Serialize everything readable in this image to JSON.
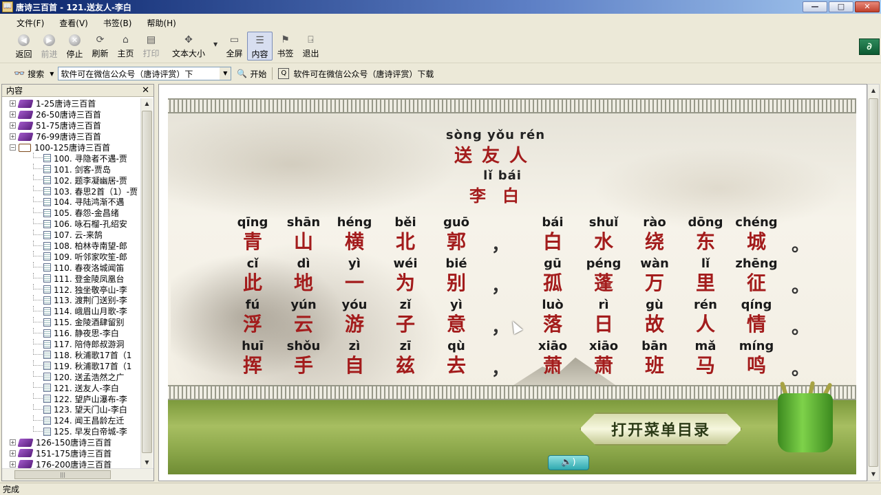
{
  "window": {
    "title": "唐诗三百首 - 121.送友人-李白",
    "buttons": {
      "minimize": "—",
      "maximize": "□",
      "close": "✕"
    }
  },
  "menu": [
    "文件(F)",
    "查看(V)",
    "书签(B)",
    "帮助(H)"
  ],
  "toolbar": {
    "back": "返回",
    "forward": "前进",
    "stop": "停止",
    "refresh": "刷新",
    "home": "主页",
    "print": "打印",
    "text_size": "文本大小",
    "fullscreen": "全屏",
    "contents": "内容",
    "bookmarks": "书签",
    "exit": "退出"
  },
  "searchbar": {
    "search_label": "搜索",
    "combo_value": "软件可在微信公众号（唐诗评赏）下",
    "go_label": "开始",
    "notice": "软件可在微信公众号（唐诗评赏）下载"
  },
  "sidepanel": {
    "header": "内容",
    "close": "✕",
    "tree": [
      {
        "label": "1-25唐诗三百首",
        "type": "book"
      },
      {
        "label": "26-50唐诗三百首",
        "type": "book"
      },
      {
        "label": "51-75唐诗三百首",
        "type": "book"
      },
      {
        "label": "76-99唐诗三百首",
        "type": "book"
      },
      {
        "label": "100-125唐诗三百首",
        "type": "open"
      },
      {
        "label": "100. 寻隐者不遇-贾",
        "type": "page"
      },
      {
        "label": "101. 剑客-贾岛",
        "type": "page"
      },
      {
        "label": "102. 题李凝幽居-贾",
        "type": "page"
      },
      {
        "label": "103. 春思2首（1）-贾",
        "type": "page"
      },
      {
        "label": "104. 寻陆鸿渐不遇",
        "type": "page"
      },
      {
        "label": "105. 春怨-金昌绪",
        "type": "page"
      },
      {
        "label": "106. 咏石榴-孔绍安",
        "type": "page"
      },
      {
        "label": "107. 云-来鹄",
        "type": "page"
      },
      {
        "label": "108. 柏林寺南望-郎",
        "type": "page"
      },
      {
        "label": "109. 听邻家吹笙-郎",
        "type": "page"
      },
      {
        "label": "110. 春夜洛城闻笛",
        "type": "page"
      },
      {
        "label": "111. 登金陵凤凰台",
        "type": "page"
      },
      {
        "label": "112. 独坐敬亭山-李",
        "type": "page"
      },
      {
        "label": "113. 渡荆门送别-李",
        "type": "page"
      },
      {
        "label": "114. 峨眉山月歌-李",
        "type": "page"
      },
      {
        "label": "115. 金陵酒肆留别",
        "type": "page"
      },
      {
        "label": "116. 静夜思-李白",
        "type": "page"
      },
      {
        "label": "117. 陪侍郎叔游洞",
        "type": "page"
      },
      {
        "label": "118. 秋浦歌17首（1",
        "type": "page"
      },
      {
        "label": "119. 秋浦歌17首（1",
        "type": "page"
      },
      {
        "label": "120. 送孟浩然之广",
        "type": "page"
      },
      {
        "label": "121. 送友人-李白",
        "type": "page",
        "selected": true
      },
      {
        "label": "122. 望庐山瀑布-李",
        "type": "page"
      },
      {
        "label": "123. 望天门山-李白",
        "type": "page"
      },
      {
        "label": "124. 闻王昌龄左迁",
        "type": "page"
      },
      {
        "label": "125. 早发白帝城-李",
        "type": "page"
      },
      {
        "label": "126-150唐诗三百首",
        "type": "book"
      },
      {
        "label": "151-175唐诗三百首",
        "type": "book"
      },
      {
        "label": "176-200唐诗三百首",
        "type": "book"
      }
    ]
  },
  "poem": {
    "title_pinyin": "sòng yǒu rén",
    "title": "送友人",
    "author_pinyin": "lǐ bái",
    "author": "李白",
    "lines": [
      {
        "left": [
          [
            "qīng",
            "青"
          ],
          [
            "shān",
            "山"
          ],
          [
            "héng",
            "横"
          ],
          [
            "běi",
            "北"
          ],
          [
            "guō",
            "郭"
          ]
        ],
        "mid": "，",
        "right": [
          [
            "bái",
            "白"
          ],
          [
            "shuǐ",
            "水"
          ],
          [
            "rào",
            "绕"
          ],
          [
            "dōng",
            "东"
          ],
          [
            "chéng",
            "城"
          ]
        ],
        "end": "。"
      },
      {
        "left": [
          [
            "cǐ",
            "此"
          ],
          [
            "dì",
            "地"
          ],
          [
            "yì",
            "一"
          ],
          [
            "wéi",
            "为"
          ],
          [
            "bié",
            "别"
          ]
        ],
        "mid": "，",
        "right": [
          [
            "gū",
            "孤"
          ],
          [
            "péng",
            "蓬"
          ],
          [
            "wàn",
            "万"
          ],
          [
            "lǐ",
            "里"
          ],
          [
            "zhēng",
            "征"
          ]
        ],
        "end": "。"
      },
      {
        "left": [
          [
            "fú",
            "浮"
          ],
          [
            "yún",
            "云"
          ],
          [
            "yóu",
            "游"
          ],
          [
            "zǐ",
            "子"
          ],
          [
            "yì",
            "意"
          ]
        ],
        "mid": "，",
        "right": [
          [
            "luò",
            "落"
          ],
          [
            "rì",
            "日"
          ],
          [
            "gù",
            "故"
          ],
          [
            "rén",
            "人"
          ],
          [
            "qíng",
            "情"
          ]
        ],
        "end": "。"
      },
      {
        "left": [
          [
            "huī",
            "挥"
          ],
          [
            "shǒu",
            "手"
          ],
          [
            "zì",
            "自"
          ],
          [
            "zī",
            "兹"
          ],
          [
            "qù",
            "去"
          ]
        ],
        "mid": "，",
        "right": [
          [
            "xiāo",
            "萧"
          ],
          [
            "xiāo",
            "萧"
          ],
          [
            "bān",
            "班"
          ],
          [
            "mǎ",
            "马"
          ],
          [
            "míng",
            "鸣"
          ]
        ],
        "end": "。"
      }
    ],
    "menu_button": "打开菜单目录",
    "sound_button": "🔈)"
  },
  "status": {
    "text": "完成"
  }
}
